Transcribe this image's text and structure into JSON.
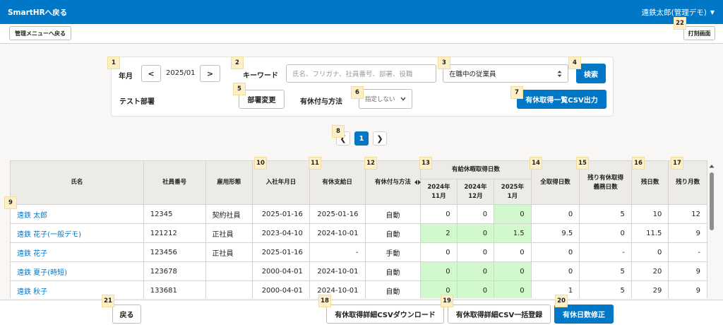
{
  "topbar": {
    "back_label": "SmartHRへ戻る",
    "user_label": "遠鉄太郎(管理デモ)",
    "caret": "▼"
  },
  "subbar": {
    "admin_back_label": "管理メニューへ戻る",
    "clock_label": "打刻画面"
  },
  "filters": {
    "month_label": "年月",
    "prev_label": "<",
    "month_value": "2025/01",
    "next_label": ">",
    "keyword_label": "キーワード",
    "keyword_placeholder": "氏名、フリガナ、社員番号、部署、役職",
    "status_value": "在職中の従業員",
    "search_label": "検索",
    "department_text": "テスト部署",
    "dept_change_label": "部署変更",
    "grant_method_label": "有休付与方法",
    "grant_method_value": "指定しない",
    "csv_export_label": "有休取得一覧CSV出力"
  },
  "pager": {
    "prev": "❮",
    "current": "1",
    "next": "❯"
  },
  "badges": [
    "1",
    "2",
    "3",
    "4",
    "5",
    "6",
    "7",
    "8",
    "9",
    "10",
    "11",
    "12",
    "13",
    "14",
    "15",
    "16",
    "17",
    "18",
    "19",
    "20",
    "21",
    "22"
  ],
  "table": {
    "headers": {
      "name": "氏名",
      "emp_no": "社員番号",
      "employment": "雇用形態",
      "hire_date": "入社年月日",
      "grant_date": "有休支給日",
      "grant_method": "有休付与方法",
      "group": "有給休暇取得日数",
      "m1_year": "2024年",
      "m1_month": "11月",
      "m2_year": "2024年",
      "m2_month": "12月",
      "m3_year": "2025年",
      "m3_month": "1月",
      "total": "全取得日数",
      "remaining_l1": "残り有休取得",
      "remaining_l2": "義務日数",
      "balance": "残日数",
      "months_left": "残り月数"
    },
    "rows": [
      {
        "name": "遠鉄 太郎",
        "emp_no": "12345",
        "employment": "契約社員",
        "hire": "2025-01-16",
        "grant": "2025-01-16",
        "method": "自動",
        "m1": "0",
        "m2": "0",
        "m3": "0",
        "total": "0",
        "remain": "5",
        "balance": "10",
        "months": "12",
        "green": [
          false,
          false,
          true
        ]
      },
      {
        "name": "遠鉄 花子(一般デモ)",
        "emp_no": "121212",
        "employment": "正社員",
        "hire": "2023-04-10",
        "grant": "2024-10-01",
        "method": "自動",
        "m1": "2",
        "m2": "0",
        "m3": "1.5",
        "total": "9.5",
        "remain": "0",
        "balance": "11.5",
        "months": "9",
        "green": [
          true,
          true,
          true
        ]
      },
      {
        "name": "遠鉄 花子",
        "emp_no": "123456",
        "employment": "正社員",
        "hire": "2025-01-16",
        "grant": "-",
        "method": "手動",
        "m1": "0",
        "m2": "0",
        "m3": "0",
        "total": "0",
        "remain": "-",
        "balance": "0",
        "months": "-",
        "green": [
          false,
          false,
          false
        ]
      },
      {
        "name": "遠鉄 夏子(時短)",
        "emp_no": "123678",
        "employment": "",
        "hire": "2000-04-01",
        "grant": "2024-10-01",
        "method": "自動",
        "m1": "0",
        "m2": "0",
        "m3": "0",
        "total": "0",
        "remain": "5",
        "balance": "20",
        "months": "9",
        "green": [
          true,
          true,
          true
        ]
      },
      {
        "name": "遠鉄 秋子",
        "emp_no": "133681",
        "employment": "",
        "hire": "2000-04-01",
        "grant": "2024-10-01",
        "method": "自動",
        "m1": "0",
        "m2": "0",
        "m3": "0",
        "total": "1",
        "remain": "5",
        "balance": "29",
        "months": "9",
        "green": [
          true,
          true,
          true
        ]
      }
    ]
  },
  "bottom": {
    "back_label": "戻る",
    "csv_download_label": "有休取得詳細CSVダウンロード",
    "csv_import_label": "有休取得詳細CSV一括登録",
    "fix_days_label": "有休日数修正"
  },
  "colors": {
    "primary": "#0077c7",
    "highlight_green": "#d1f9cd",
    "badge": "#fdf0c8"
  }
}
